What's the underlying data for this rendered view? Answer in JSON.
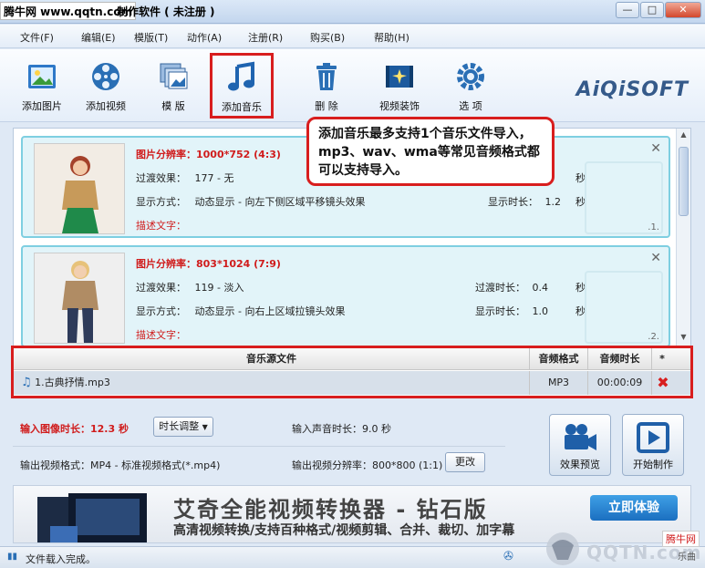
{
  "window": {
    "watermark": "腾牛网 www.qqtn.com",
    "title": "制作软件 ( 未注册 )",
    "min": "—",
    "max": "□",
    "close": "✕"
  },
  "menu": [
    "文件(F)",
    "编辑(E)",
    "模版(T)",
    "动作(A)",
    "注册(R)",
    "购买(B)",
    "帮助(H)"
  ],
  "toolbar": {
    "items": [
      "添加图片",
      "添加视频",
      "模 版",
      "添加音乐",
      "删 除",
      "视频装饰",
      "选 项"
    ],
    "logo": "AiQiSOFT"
  },
  "callout": "添加音乐最多支持1个音乐文件导入，mp3、wav、wma等常见音频格式都可以支持导入。",
  "cards": [
    {
      "resolution": "图片分辨率：1000*752 (4:3)",
      "transition_label": "过渡效果：",
      "transition": "177 - 无",
      "display_label": "显示方式：",
      "display": "动态显示 - 向左下侧区域平移镜头效果",
      "desc": "描述文字：",
      "trans_dur_label": "过渡时长：",
      "trans_dur": "",
      "show_dur_label": "显示时长：",
      "show_dur": "1.2",
      "unit1": "秒",
      "unit2": "秒",
      "num": ".1."
    },
    {
      "resolution": "图片分辨率：803*1024 (7:9)",
      "transition_label": "过渡效果：",
      "transition": "119 - 淡入",
      "display_label": "显示方式：",
      "display": "动态显示 - 向右上区域拉镜头效果",
      "desc": "描述文字：",
      "trans_dur_label": "过渡时长：",
      "trans_dur": "0.4",
      "show_dur_label": "显示时长：",
      "show_dur": "1.0",
      "unit1": "秒",
      "unit2": "秒",
      "num": ".2."
    }
  ],
  "music": {
    "headers": [
      "音乐源文件",
      "音频格式",
      "音频时长",
      "*"
    ],
    "rows": [
      {
        "file": "1.古典抒情.mp3",
        "format": "MP3",
        "duration": "00:00:09"
      }
    ]
  },
  "settings": {
    "input_image_duration": "输入图像时长：12.3 秒",
    "duration_adjust": "时长调整",
    "input_audio_duration": "输入声音时长：9.0 秒",
    "output_format": "输出视频格式：MP4 - 标准视频格式(*.mp4)",
    "output_resolution": "输出视频分辨率：800*800 (1:1)",
    "change": "更改",
    "preview": "效果预览",
    "start": "开始制作"
  },
  "ad": {
    "title": "艾奇全能视频转换器 - 钻石版",
    "subtitle": "高清视频转换/支持百种格式/视频剪辑、合并、裁切、加字幕",
    "button": "立即体验"
  },
  "status": {
    "text": "文件载入完成。"
  },
  "watermark_br": {
    "site": "腾牛网",
    "logo": "QQTN.com",
    "extra": "乐曲"
  },
  "colors": {
    "highlight": "#d81e1e",
    "card_bg": "#e2f4f9",
    "accent_blue": "#1b6fc0"
  }
}
